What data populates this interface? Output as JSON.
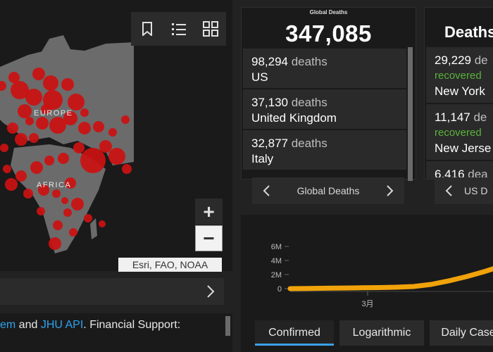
{
  "map": {
    "labels": {
      "europe": "EUROPE",
      "africa": "AFRICA"
    },
    "attribution": "Esri, FAO, NOAA",
    "toolbar": [
      "bookmark-icon",
      "list-icon",
      "grid-icon"
    ],
    "zoom_in": "+",
    "zoom_out": "−",
    "colors": {
      "bubble": "#cc1111",
      "land": "#6e6e6e",
      "water": "#1a1a1a"
    }
  },
  "credits": {
    "link1": "em",
    "joiner": " and ",
    "link2": "JHU API",
    "rest": ". Financial Support:"
  },
  "global_deaths": {
    "title": "Global Deaths",
    "total": "347,085",
    "nav_label": "Global Deaths",
    "items": [
      {
        "count": "98,294",
        "unit": " deaths",
        "place": "US"
      },
      {
        "count": "37,130",
        "unit": " deaths",
        "place": "United Kingdom"
      },
      {
        "count": "32,877",
        "unit": " deaths",
        "place": "Italy"
      }
    ]
  },
  "us_deaths": {
    "title": "Deaths,",
    "nav_label": "US D",
    "items": [
      {
        "count": "29,229",
        "unit": " de",
        "status": "recovered",
        "place": "New York"
      },
      {
        "count": "11,147",
        "unit": " de",
        "status": "recovered",
        "place": "New Jerse"
      },
      {
        "count": "6,416",
        "unit": " dea",
        "status": "",
        "place": ""
      }
    ]
  },
  "chart_data": {
    "type": "line",
    "y_ticks": [
      "6M",
      "4M",
      "2M",
      "0"
    ],
    "x_ticks": [
      "3月"
    ],
    "ylim": [
      0,
      7000000
    ],
    "series": [
      {
        "color": "#f0a30a",
        "values": [
          0,
          30000,
          60000,
          90000,
          120000,
          150000,
          200000,
          300000,
          600000,
          1100000,
          1700000,
          2400000,
          3200000
        ]
      }
    ]
  },
  "tabs": [
    {
      "label": "Confirmed",
      "active": true
    },
    {
      "label": "Logarithmic",
      "active": false
    },
    {
      "label": "Daily Case",
      "active": false
    }
  ]
}
